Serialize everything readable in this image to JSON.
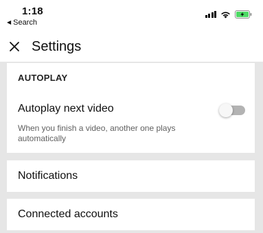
{
  "status_bar": {
    "time": "1:18",
    "back_label": "Search",
    "back_icon": "triangle-left-icon",
    "icons": [
      "cellular-signal-icon",
      "wifi-icon",
      "battery-charging-icon"
    ],
    "battery_color": "#4cd964"
  },
  "header": {
    "close_icon": "close-icon",
    "title": "Settings"
  },
  "autoplay": {
    "section_heading": "AUTOPLAY",
    "title": "Autoplay next video",
    "description": "When you finish a video, another one plays automatically",
    "enabled": false
  },
  "items": {
    "notifications": "Notifications",
    "connected_accounts": "Connected accounts"
  },
  "colors": {
    "background_gray": "#e6e6e6",
    "toggle_off_track": "#b3b3b3",
    "secondary_text": "#606060"
  }
}
